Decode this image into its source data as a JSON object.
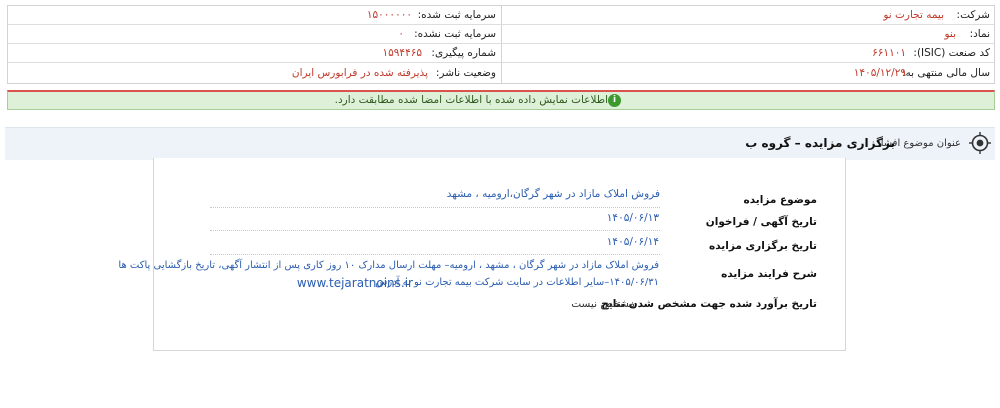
{
  "company": {
    "company_label": "شرکت:",
    "company_value": "بیمه تجارت نو",
    "symbol_label": "نماد:",
    "symbol_value": "بنو",
    "isic_label": "کد صنعت (ISIC):",
    "isic_value": "۶۶۱۱۰۱",
    "fiscal_label": "سال مالی منتهی به:",
    "fiscal_value": "۱۴۰۵/۱۲/۲۹",
    "registered_capital_label": "سرمایه ثبت شده:",
    "registered_capital_value": "۱۵۰۰۰۰۰۰",
    "unregistered_capital_label": "سرمایه ثبت نشده:",
    "unregistered_capital_value": "۰",
    "tracking_label": "شماره پیگیری:",
    "tracking_value": "۱۵۹۴۴۶۵",
    "publisher_status_label": "وضعیت ناشر:",
    "publisher_status_value": "پذیرفته شده در فرابورس ایران"
  },
  "notice": {
    "icon": "info-icon",
    "text": "اطلاعات نمایش داده شده با اطلاعات امضا شده مطابقت دارد."
  },
  "subject": {
    "icon": "target-icon",
    "label": "عنوان موضوع افشا:",
    "title": "برگزاری مزایده – گروه ب"
  },
  "details": {
    "auction_subject_label": "موضوع مزایده",
    "auction_subject_value": "فروش املاک مازاد در شهر گرگان،ارومیه ، مشهد",
    "announcement_date_label": "تاریخ آگهی / فراخوان",
    "announcement_date_value": "۱۴۰۵/۰۶/۱۳",
    "auction_date_label": "تاریخ برگزاری مزایده",
    "auction_date_value": "۱۴۰۵/۰۶/۱۴",
    "process_label": "شرح فرایند مزایده",
    "process_line1": "فروش املاک مازاد در شهر گرگان ، مشهد ، ارومیه– مهلت ارسال مدارک ۱۰ روز کاری پس از انتشار آگهی، تاریخ بازگشایی پاکت ها",
    "process_line2": "۱۴۰۵/۰۶/۳۱–سایر اطلاعات در سایت شرکت بیمه تجارت نو به آدرس",
    "process_site": "www.tejaratnoins.ir",
    "estimated_date_label": "تاریخ برآورد شده جهت مشخص شدن نتایج",
    "estimated_date_value": "مشخص نیست"
  },
  "colors": {
    "value_red": "#c0392b",
    "link_blue": "#2a5db0",
    "notice_green_bg": "#dff0d8",
    "notice_red_border": "#d9534f",
    "subject_bar_bg": "#eef3f9"
  }
}
